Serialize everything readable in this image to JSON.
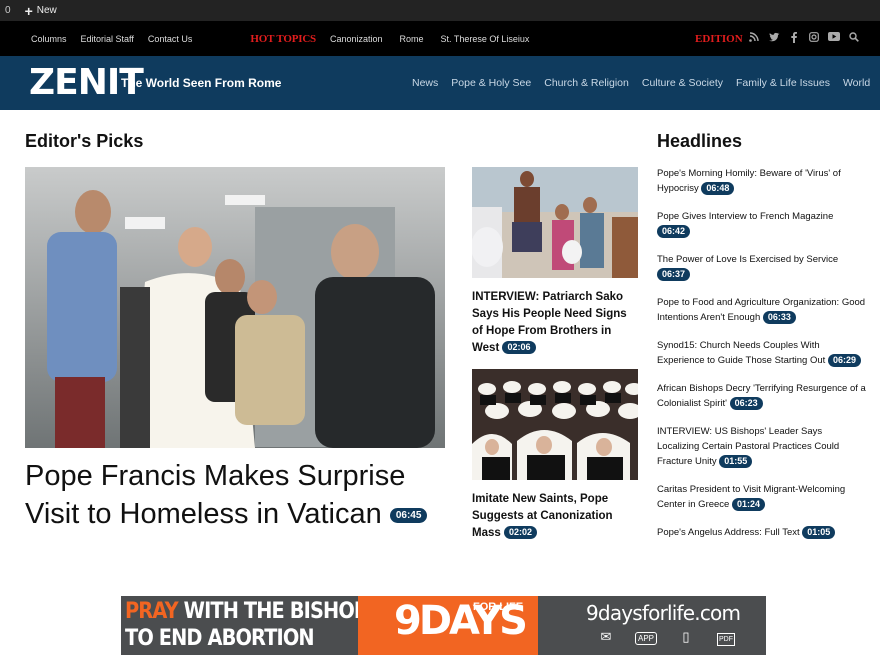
{
  "adminbar": {
    "count": "0",
    "new_label": "New"
  },
  "topnav": {
    "links": [
      "Columns",
      "Editorial Staff",
      "Contact Us"
    ],
    "hot_label": "HOT TOPICS",
    "hot_links": [
      "Canonization",
      "Rome",
      "St. Therese Of Liseiux"
    ],
    "edition_label": "EDITION",
    "social_icons": [
      "rss-icon",
      "twitter-icon",
      "facebook-icon",
      "instagram-icon",
      "youtube-icon",
      "search-icon"
    ]
  },
  "header": {
    "logo": "ZENIT",
    "tagline": "The World Seen From Rome",
    "nav": [
      "News",
      "Pope & Holy See",
      "Church & Religion",
      "Culture & Society",
      "Family & Life Issues",
      "World"
    ]
  },
  "editors_picks": {
    "title": "Editor's Picks",
    "hero": {
      "title": "Pope Francis Makes Surprise Visit to Homeless in Vatican",
      "time": "06:45"
    },
    "cards": [
      {
        "title": "INTERVIEW: Patriarch Sako Says His People Need Signs of Hope From Brothers in West",
        "time": "02:06"
      },
      {
        "title": "Imitate New Saints, Pope Suggests at Canonization Mass",
        "time": "02:02"
      }
    ]
  },
  "headlines": {
    "title": "Headlines",
    "items": [
      {
        "text": "Pope's Morning Homily: Beware of 'Virus' of Hypocrisy",
        "time": "06:48"
      },
      {
        "text": "Pope Gives Interview to French Magazine",
        "time": "06:42"
      },
      {
        "text": "The Power of Love Is Exercised by Service",
        "time": "06:37"
      },
      {
        "text": "Pope to Food and Agriculture Organization: Good Intentions Aren't Enough",
        "time": "06:33"
      },
      {
        "text": "Synod15: Church Needs Couples With Experience to Guide Those Starting Out",
        "time": "06:29"
      },
      {
        "text": "African Bishops Decry 'Terrifying Resurgence of a Colonialist Spirit'",
        "time": "06:23"
      },
      {
        "text": "INTERVIEW: US Bishops' Leader Says Localizing Certain Pastoral Practices Could Fracture Unity",
        "time": "01:55"
      },
      {
        "text": "Caritas President to Visit Migrant-Welcoming Center in Greece",
        "time": "01:24"
      },
      {
        "text": "Pope's Angelus Address: Full Text",
        "time": "01:05"
      }
    ]
  },
  "ad": {
    "line1_accent": "PRAY",
    "line1_rest": " WITH THE BISHOPS",
    "line2": "TO END ABORTION",
    "days": "9DAYS",
    "for_life": "FOR LIFE",
    "site": "9daysforlife.com",
    "icons": [
      "email-icon",
      "app-icon",
      "phone-icon",
      "pdf-icon"
    ],
    "app_label": "APP",
    "pdf_label": "PDF"
  }
}
